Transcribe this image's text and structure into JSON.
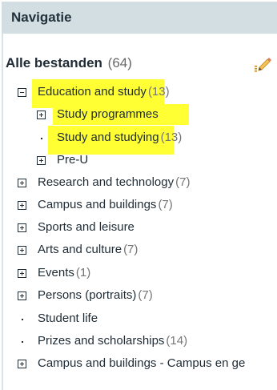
{
  "panel": {
    "title": "Navigatie",
    "root_label": "Alle bestanden",
    "root_count": "(64)",
    "edit_icon": "pencil-edit-icon",
    "highlight_color": "#ffff33"
  },
  "tree": {
    "education": {
      "label": "Education and study",
      "count": "(13)"
    },
    "study_programmes": {
      "label": "Study programmes"
    },
    "study_and_studying": {
      "label": "Study and studying",
      "count": "(13)"
    },
    "pre_u": {
      "label": "Pre-U"
    },
    "research": {
      "label": "Research and technology",
      "count": "(7)"
    },
    "campus": {
      "label": "Campus and buildings",
      "count": "(7)"
    },
    "sports": {
      "label": "Sports and leisure"
    },
    "arts": {
      "label": "Arts and culture",
      "count": "(7)"
    },
    "events": {
      "label": "Events",
      "count": "(1)"
    },
    "persons": {
      "label": "Persons (portraits)",
      "count": "(7)"
    },
    "student_life": {
      "label": "Student life"
    },
    "prizes": {
      "label": "Prizes and scholarships",
      "count": "(14)"
    },
    "campus_nl": {
      "label": "Campus and buildings - Campus en ge"
    }
  }
}
